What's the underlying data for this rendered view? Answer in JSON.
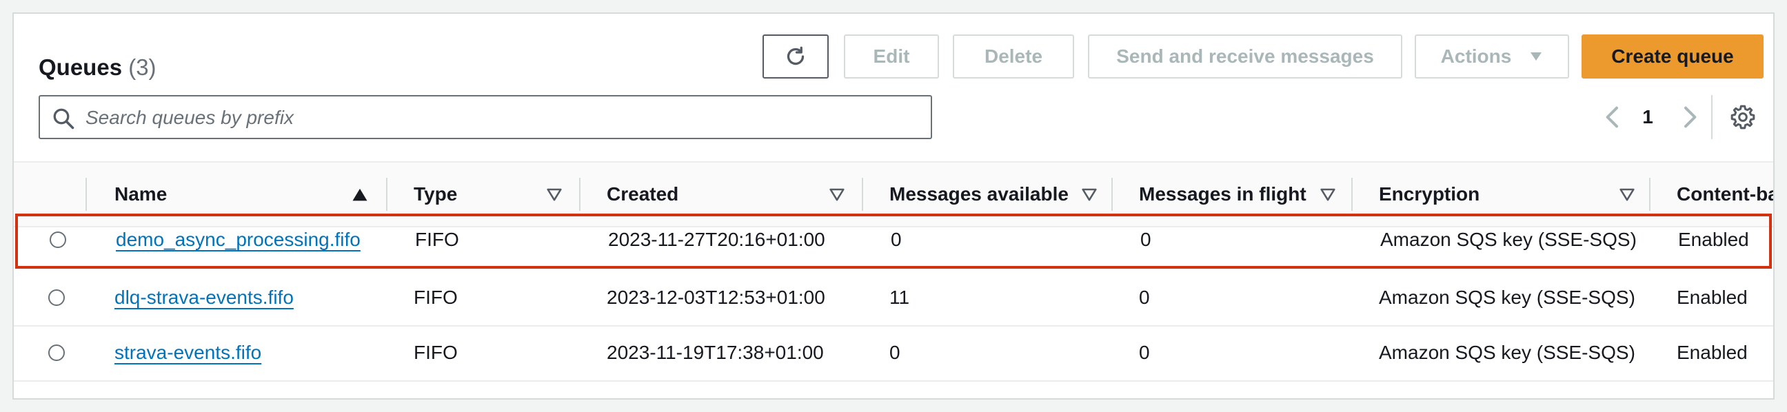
{
  "header": {
    "title": "Queues",
    "count": "(3)"
  },
  "toolbar": {
    "edit_label": "Edit",
    "delete_label": "Delete",
    "send_receive_label": "Send and receive messages",
    "actions_label": "Actions",
    "create_label": "Create queue"
  },
  "search": {
    "placeholder": "Search queues by prefix",
    "value": ""
  },
  "pagination": {
    "current_page": "1"
  },
  "columns": {
    "name": "Name",
    "type": "Type",
    "created": "Created",
    "messages_available": "Messages available",
    "messages_in_flight": "Messages in flight",
    "encryption": "Encryption",
    "content_based": "Content-ba"
  },
  "rows": [
    {
      "name": "demo_async_processing.fifo",
      "type": "FIFO",
      "created": "2023-11-27T20:16+01:00",
      "messages_available": "0",
      "messages_in_flight": "0",
      "encryption": "Amazon SQS key (SSE-SQS)",
      "content_based": "Enabled",
      "selected": true
    },
    {
      "name": "dlq-strava-events.fifo",
      "type": "FIFO",
      "created": "2023-12-03T12:53+01:00",
      "messages_available": "11",
      "messages_in_flight": "0",
      "encryption": "Amazon SQS key (SSE-SQS)",
      "content_based": "Enabled",
      "selected": false
    },
    {
      "name": "strava-events.fifo",
      "type": "FIFO",
      "created": "2023-11-19T17:38+01:00",
      "messages_available": "0",
      "messages_in_flight": "0",
      "encryption": "Amazon SQS key (SSE-SQS)",
      "content_based": "Enabled",
      "selected": false
    }
  ],
  "icons": {
    "refresh": "refresh-icon",
    "search": "search-icon",
    "settings": "gear-icon",
    "sort_asc": "sort-ascending-icon",
    "sort": "sort-icon",
    "caret": "caret-down-icon",
    "prev": "chevron-left-icon",
    "next": "chevron-right-icon"
  },
  "colors": {
    "primary": "#ec9a2e",
    "link": "#0073bb",
    "highlight": "#d13212",
    "disabled": "#aab7b8"
  }
}
